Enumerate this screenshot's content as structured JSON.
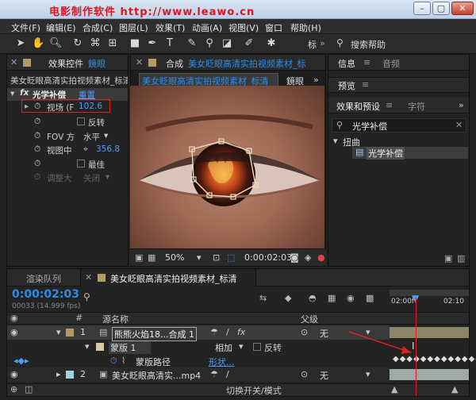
{
  "window": {
    "watermark": "电影制作软件     http://www.leawo.cn",
    "controls": [
      "–",
      "▢",
      "✕"
    ]
  },
  "menu": [
    "文件(F)",
    "编辑(E)",
    "合成(C)",
    "图层(L)",
    "效果(T)",
    "动画(A)",
    "视图(V)",
    "窗口",
    "帮助(H)"
  ],
  "toolbar": {
    "workspace": "标",
    "search_label": "搜索帮助"
  },
  "effects_panel": {
    "tab": "效果控件",
    "tab_suffix": "鏡眼",
    "layer": "美女眨眼高清实拍视频素材_标清",
    "effect_name": "光学补偿",
    "reset": "重置",
    "props": [
      {
        "label": "视场 (F",
        "value": "102.6"
      },
      {
        "label": "反转",
        "value": ""
      },
      {
        "label": "FOV 方",
        "value": "水平"
      },
      {
        "label": "视图中",
        "value": "356.8"
      },
      {
        "label": "最佳",
        "value": ""
      },
      {
        "label": "调整大",
        "value": "关闭"
      }
    ]
  },
  "composition": {
    "tab": "合成",
    "tab_name": "美女眨眼高清实拍视频素材_标",
    "sub_tab": "美女眨眼高清实拍视频素材_标清",
    "sub_tab2": "鏡眼",
    "zoom": "50%",
    "timecode": "0:00:02:03"
  },
  "right_panel": {
    "tabs": [
      "信息",
      "音频"
    ],
    "preview": "预览",
    "effects_tab": "效果和预设",
    "char_tab": "字符",
    "search": "光学补偿",
    "category": "扭曲",
    "item": "光学补偿"
  },
  "timeline": {
    "queue_tab": "渲染队列",
    "comp_tab": "美女眨眼高清实拍视频素材_标清",
    "timecode": "0:00:02:03",
    "fps": "00033 (14.999 fps)",
    "col_source": "源名称",
    "col_parent": "父级",
    "ruler": [
      "02:00f",
      "02:10"
    ],
    "layers": [
      {
        "num": "1",
        "name": "熊熊火焰18...合成 1",
        "parent": "无"
      },
      {
        "num": "",
        "name": "蒙版 1",
        "mode": "相加",
        "invert": "反转"
      },
      {
        "num": "",
        "name": "蒙版路径",
        "value": "形状..."
      },
      {
        "num": "2",
        "name": "美女眨眼高清实...mp4",
        "parent": "无"
      }
    ],
    "footer": "切换开关/模式"
  }
}
